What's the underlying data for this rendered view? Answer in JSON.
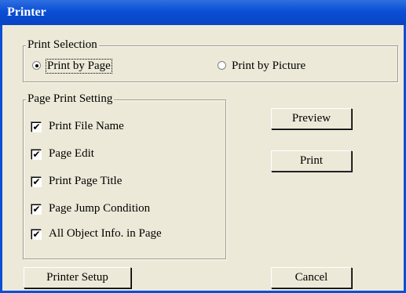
{
  "window": {
    "title": "Printer"
  },
  "print_selection": {
    "legend": "Print Selection",
    "options": [
      {
        "label": "Print by Page",
        "selected": true
      },
      {
        "label": "Print by Picture",
        "selected": false
      }
    ]
  },
  "page_print_setting": {
    "legend": "Page Print Setting",
    "items": [
      {
        "label": "Print File Name",
        "checked": true
      },
      {
        "label": "Page Edit",
        "checked": true
      },
      {
        "label": "Print Page Title",
        "checked": true
      },
      {
        "label": "Page Jump Condition",
        "checked": true
      },
      {
        "label": "All Object Info. in Page",
        "checked": true
      }
    ]
  },
  "buttons": {
    "preview": "Preview",
    "print": "Print",
    "printer_setup": "Printer Setup",
    "cancel": "Cancel"
  },
  "check_mark": "✔",
  "colors": {
    "titlebar": "#0a4fd6",
    "dialog_bg": "#ece9d8"
  }
}
